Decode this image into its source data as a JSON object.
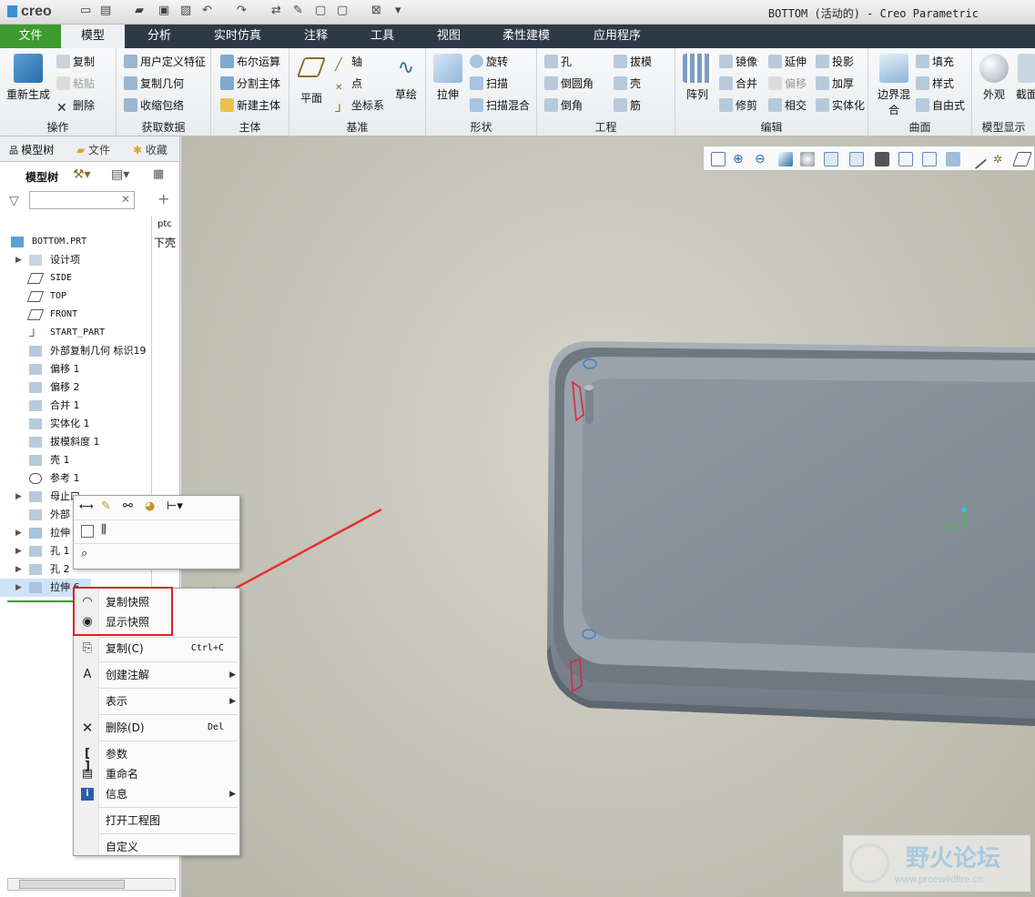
{
  "app": {
    "logo": "creo",
    "window_title": "BOTTOM (活动的) - Creo Parametric"
  },
  "menu": {
    "file": "文件",
    "tabs": [
      "模型",
      "分析",
      "实时仿真",
      "注释",
      "工具",
      "视图",
      "柔性建模",
      "应用程序"
    ]
  },
  "ribbon": {
    "groups": [
      "操作",
      "获取数据",
      "主体",
      "基准",
      "形状",
      "工程",
      "编辑",
      "曲面",
      "模型显示"
    ],
    "operations": {
      "regenerate": "重新生成",
      "copy": "复制",
      "paste": "粘贴",
      "delete": "删除"
    },
    "getdata": {
      "udf": "用户定义特征",
      "copy_geom": "复制几何",
      "shrinkwrap": "收缩包络"
    },
    "body": {
      "boolean": "布尔运算",
      "split": "分割主体",
      "new": "新建主体"
    },
    "datum": {
      "plane": "平面",
      "axis": "轴",
      "point": "点",
      "csys": "坐标系",
      "sketch": "草绘"
    },
    "shape": {
      "extrude": "拉伸",
      "revolve": "旋转",
      "sweep": "扫描",
      "swept_blend": "扫描混合"
    },
    "engineering": {
      "hole": "孔",
      "round": "倒圆角",
      "chamfer": "倒角",
      "draft": "拔模",
      "shell": "壳",
      "rib": "筋"
    },
    "edit": {
      "pattern": "阵列",
      "mirror": "镜像",
      "merge": "合并",
      "trim": "修剪",
      "extend": "延伸",
      "offset": "偏移",
      "intersect": "相交",
      "project": "投影",
      "thicken": "加厚",
      "solidify": "实体化"
    },
    "surfaces": {
      "boundary_blend": "边界混合",
      "fill": "填充",
      "style": "样式",
      "freestyle": "自由式"
    },
    "model_display": {
      "appearance": "外观",
      "section": "截面"
    }
  },
  "left_panel": {
    "tabs": [
      "模型树",
      "文件",
      "收藏"
    ],
    "tree_title": "模型树",
    "col_header": "ptc",
    "col_value": "下壳",
    "items": [
      "BOTTOM.PRT",
      "设计项",
      "SIDE",
      "TOP",
      "FRONT",
      "START_PART",
      "外部复制几何 标识19",
      "偏移 1",
      "偏移 2",
      "合并 1",
      "实体化 1",
      "拔模斜度 1",
      "壳 1",
      "参考 1",
      "母止口",
      "外部",
      "拉伸",
      "孔 1",
      "孔 2",
      "拉伸 6"
    ]
  },
  "context_menu": {
    "items": [
      {
        "label": "复制快照",
        "shortcut": ""
      },
      {
        "label": "显示快照",
        "shortcut": ""
      },
      {
        "label": "复制(C)",
        "shortcut": "Ctrl+C"
      },
      {
        "label": "创建注解",
        "shortcut": ""
      },
      {
        "label": "表示",
        "shortcut": ""
      },
      {
        "label": "删除(D)",
        "shortcut": "Del"
      },
      {
        "label": "参数",
        "shortcut": ""
      },
      {
        "label": "重命名",
        "shortcut": ""
      },
      {
        "label": "信息",
        "shortcut": ""
      },
      {
        "label": "打开工程图",
        "shortcut": ""
      },
      {
        "label": "自定义",
        "shortcut": ""
      }
    ]
  },
  "watermark": {
    "title": "野火论坛",
    "url": "www.proewildfire.cn"
  },
  "colors": {
    "menubar": "#2d3a46",
    "file_tab": "#3d9a2f",
    "highlight_box": "#e02020",
    "model": "#8a949c"
  }
}
